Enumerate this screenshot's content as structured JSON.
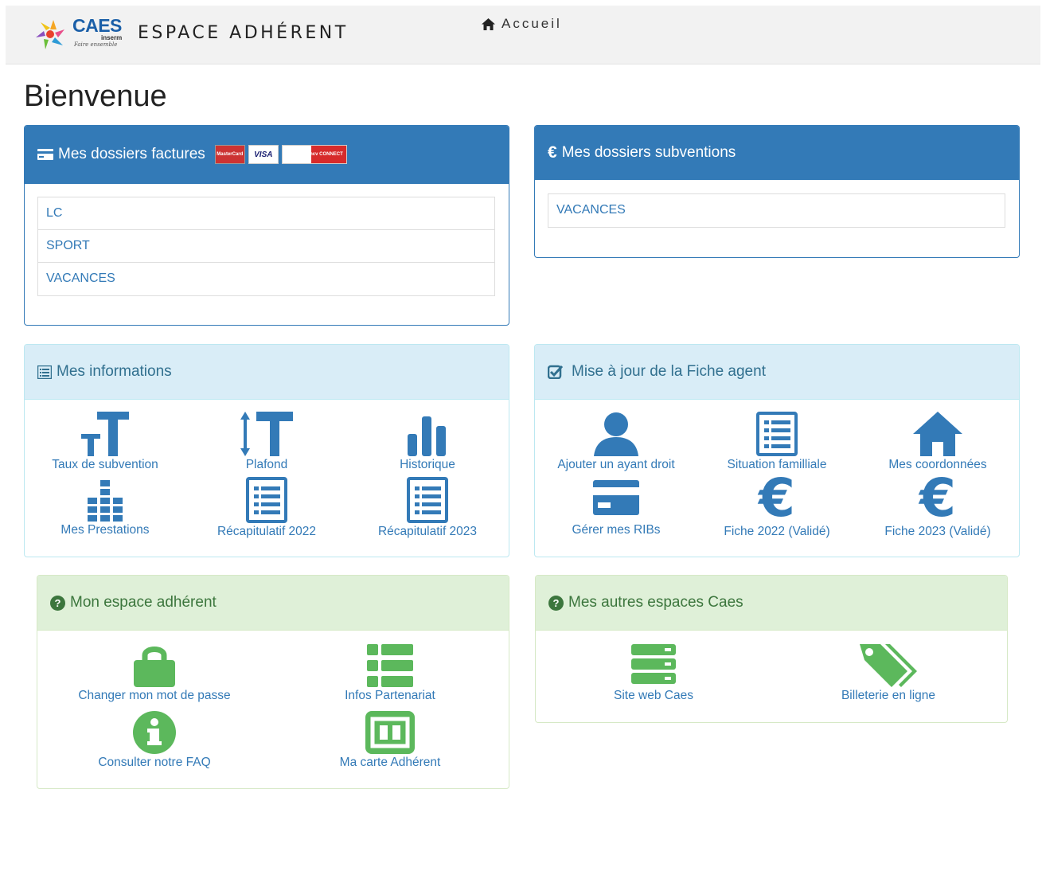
{
  "header": {
    "logo_text": "CAES",
    "logo_sub": "inserm",
    "logo_tagline": "Faire ensemble",
    "brand": "ESPACE ADHÉRENT",
    "home_label": "Accueil"
  },
  "page": {
    "title": "Bienvenue"
  },
  "factures": {
    "title": "Mes dossiers factures",
    "payment_logos": [
      "MasterCard",
      "VISA",
      "ancv CONNECT"
    ],
    "items": [
      "LC",
      "SPORT",
      "VACANCES"
    ]
  },
  "subventions": {
    "title": "Mes dossiers subventions",
    "items": [
      "VACANCES"
    ]
  },
  "informations": {
    "title": "Mes informations",
    "tiles": [
      "Taux de subvention",
      "Plafond",
      "Historique",
      "Mes Prestations",
      "Récapitulatif 2022",
      "Récapitulatif 2023"
    ]
  },
  "fiche_agent": {
    "title": "Mise à jour de la Fiche agent",
    "tiles": [
      "Ajouter un ayant droit",
      "Situation familliale",
      "Mes coordonnées",
      "Gérer mes RIBs",
      "Fiche 2022 (Validé)",
      "Fiche 2023 (Validé)"
    ]
  },
  "espace_adherent": {
    "title": "Mon espace adhérent",
    "tiles": [
      "Changer mon mot de passe",
      "Infos Partenariat",
      "Consulter notre FAQ",
      "Ma carte Adhérent"
    ]
  },
  "autres_espaces": {
    "title": "Mes autres espaces Caes",
    "tiles": [
      "Site web Caes",
      "Billeterie en ligne"
    ]
  },
  "colors": {
    "primary": "#337ab7",
    "info_bg": "#d9edf7",
    "success_bg": "#dff0d8",
    "green_icon": "#5cb85c",
    "link": "#337ab7"
  },
  "icons": [
    "home-icon",
    "credit-card-icon",
    "euro-icon",
    "list-alt-icon",
    "check-icon",
    "question-sign-icon",
    "text-height-icon",
    "text-width-icon",
    "stats-icon",
    "tasks-icon",
    "user-icon",
    "home-icon",
    "credit-card-icon",
    "lock-icon",
    "th-list-icon",
    "info-icon",
    "id-card-icon",
    "server-icon",
    "tags-icon"
  ]
}
